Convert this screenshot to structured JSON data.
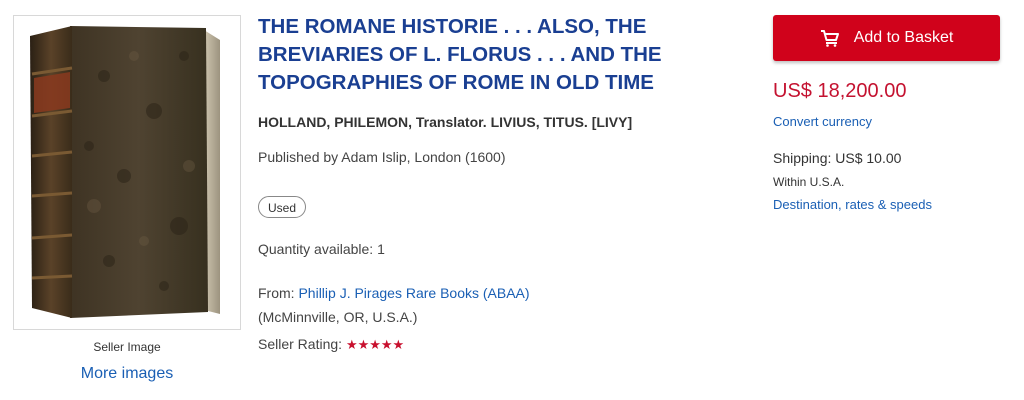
{
  "listing": {
    "title": "THE ROMANE HISTORIE . . . ALSO, THE BREVIARIES OF L. FLORUS . . . AND THE TOPOGRAPHIES OF ROME IN OLD TIME",
    "author": "HOLLAND, PHILEMON, Translator. LIVIUS, TITUS. [LIVY]",
    "published": "Published by Adam Islip, London (1600)",
    "condition_badge": "Used",
    "quantity": "Quantity available: 1",
    "from_label": "From: ",
    "seller_name": "Phillip J. Pirages Rare Books (ABAA)",
    "seller_location": "(McMinnville, OR, U.S.A.)",
    "rating_label": "Seller Rating: ",
    "rating_stars": "★★★★★",
    "rating_value": 5
  },
  "image": {
    "caption": "Seller Image",
    "more_images": "More images",
    "subject": "old-leather-bound-book"
  },
  "purchase": {
    "add_to_basket": "Add to Basket",
    "basket_icon": "shopping-cart-icon",
    "price": "US$ 18,200.00",
    "convert_currency": "Convert currency",
    "shipping": "Shipping: US$ 10.00",
    "shipping_region": "Within U.S.A.",
    "destination_link": "Destination, rates & speeds"
  },
  "colors": {
    "button_red": "#d0021b",
    "price_red": "#c41230",
    "title_blue": "#1a3f92",
    "link_blue": "#1a5fb4",
    "star_red": "#c8102e"
  }
}
